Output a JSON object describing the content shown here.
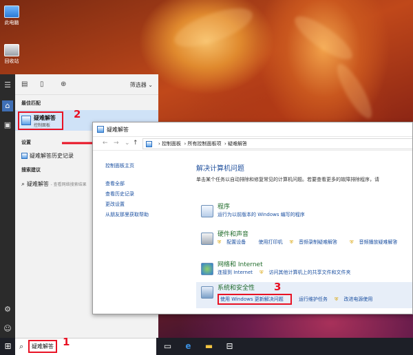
{
  "desktop": {
    "icons": [
      {
        "label": "此电脑",
        "icon": "computer-icon"
      },
      {
        "label": "回收站",
        "icon": "recycle-bin-icon"
      }
    ]
  },
  "taskbar": {
    "search_query": "疑难解答",
    "icons": [
      "windows-start-icon",
      "task-view-icon",
      "edge-icon",
      "file-explorer-icon",
      "store-icon"
    ]
  },
  "start_rail": {
    "icons": [
      "hamburger-menu-icon",
      "home-icon",
      "notebook-icon",
      "gear-icon",
      "feedback-icon"
    ]
  },
  "search_panel": {
    "filter_label": "筛选器",
    "best_match_heading": "最佳匹配",
    "best_match": {
      "title": "疑难解答",
      "subtitle": "控制面板"
    },
    "settings_heading": "设置",
    "settings_item": "疑难解答历史记录",
    "suggestions_heading": "搜索建议",
    "suggestion": {
      "text": "疑难解答",
      "hint": "- 查看网络搜索结果"
    }
  },
  "steps": [
    "1",
    "2",
    "3"
  ],
  "control_panel": {
    "title": "疑难解答",
    "breadcrumbs": [
      "控制面板",
      "所有控制面板项",
      "疑难解答"
    ],
    "left_links": {
      "home": "控制面板主页",
      "items": [
        "查看全部",
        "查看历史记录",
        "更改设置",
        "从朋友那里获取帮助"
      ]
    },
    "heading": "解决计算机问题",
    "description": "单击某个任务以自动排除和修复常见的计算机问题。若要查看更多的故障排除程序，请",
    "categories": [
      {
        "title": "程序",
        "links": [
          "运行为以前版本的 Windows 编写的程序"
        ]
      },
      {
        "title": "硬件和声音",
        "links": [
          "配置设备",
          "使用打印机",
          "音频录制疑难解答",
          "音频播放疑难解答"
        ]
      },
      {
        "title": "网络和 Internet",
        "links": [
          "连接到 Internet",
          "访问其他计算机上的共享文件和文件夹"
        ]
      },
      {
        "title": "系统和安全性",
        "links": [
          "使用 Windows 更新解决问题",
          "运行维护任务",
          "改进电源使用"
        ]
      }
    ]
  }
}
